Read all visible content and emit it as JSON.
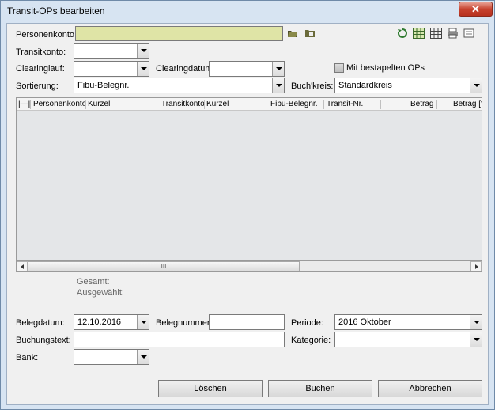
{
  "window": {
    "title": "Transit-OPs bearbeiten",
    "close_label": "✕"
  },
  "filters": {
    "personenkonto_label": "Personenkonto:",
    "personenkonto_value": "",
    "transitkonto_label": "Transitkonto:",
    "transitkonto_value": "",
    "clearinglauf_label": "Clearinglauf:",
    "clearinglauf_value": "",
    "clearingdatum_label": "Clearingdatum:",
    "clearingdatum_value": "",
    "mit_bestapelten_label": "Mit bestapelten OPs",
    "sortierung_label": "Sortierung:",
    "sortierung_value": "Fibu-Belegnr.",
    "buchkreis_label": "Buch'kreis:",
    "buchkreis_value": "Standardkreis"
  },
  "toolbar": {
    "icons": [
      "folder-open-icon",
      "folder-icon",
      "refresh-icon",
      "grid-green-icon",
      "grid-icon",
      "print-icon",
      "export-icon"
    ]
  },
  "grid": {
    "columns": [
      "|—|",
      "Personenkonto",
      "Kürzel",
      "Transitkonto",
      "Kürzel",
      "Fibu-Belegnr.",
      "Transit-Nr.",
      "Betrag",
      "Betrag [W"
    ],
    "rows": [],
    "scroll_thumb": "III"
  },
  "summary": {
    "gesamt_label": "Gesamt:",
    "ausgewaehlt_label": "Ausgewählt:"
  },
  "booking": {
    "belegdatum_label": "Belegdatum:",
    "belegdatum_value": "12.10.2016",
    "belegnummer_label": "Belegnummer:",
    "belegnummer_value": "",
    "periode_label": "Periode:",
    "periode_value": "2016  Oktober",
    "buchungstext_label": "Buchungstext:",
    "buchungstext_value": "",
    "kategorie_label": "Kategorie:",
    "kategorie_value": "",
    "bank_label": "Bank:",
    "bank_value": ""
  },
  "buttons": {
    "loeschen": "Löschen",
    "buchen": "Buchen",
    "abbrechen": "Abbrechen"
  },
  "colors": {
    "accent_field": "#dfe4a6",
    "window_frame": "#d7e4f2",
    "close": "#c7432f"
  }
}
